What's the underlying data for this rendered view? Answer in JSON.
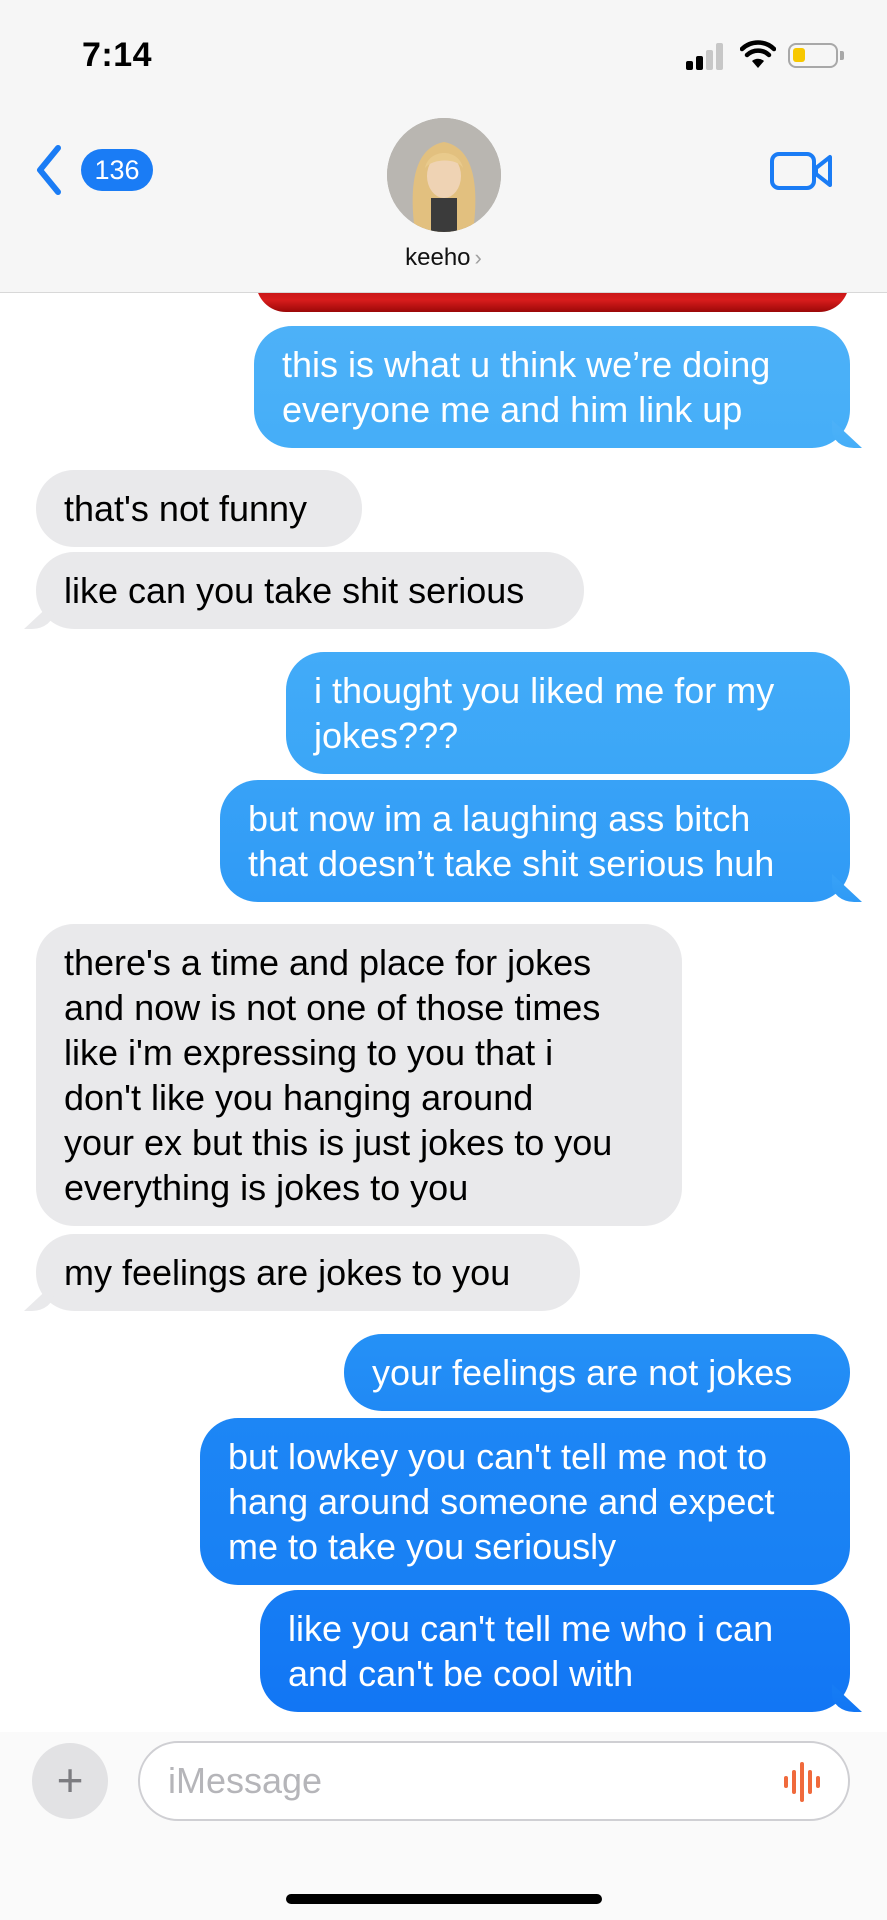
{
  "status_bar": {
    "time": "7:14"
  },
  "header": {
    "back_count": "136",
    "contact_name": "keeho",
    "name_chevron": "›"
  },
  "messages": [
    {
      "from": "me",
      "text": "this is what u think we’re doing\neveryone me and him link up"
    },
    {
      "from": "them",
      "text": "that's not funny"
    },
    {
      "from": "them",
      "text": "like can you take shit serious"
    },
    {
      "from": "me",
      "text": "i thought you liked me for my\njokes???"
    },
    {
      "from": "me",
      "text": "but now im a laughing ass bitch\nthat doesn’t take shit serious huh"
    },
    {
      "from": "them",
      "text": "there's a time and place for jokes\nand now is not one of those times\nlike i'm expressing to you that i\ndon't like you hanging around\nyour ex but this is just jokes to you\neverything is jokes to you"
    },
    {
      "from": "them",
      "text": "my feelings are jokes to you"
    },
    {
      "from": "me",
      "text": "your feelings are not jokes"
    },
    {
      "from": "me",
      "text": "but lowkey you can't tell me not to\nhang around someone and expect\nme to take you seriously"
    },
    {
      "from": "me",
      "text": "like you can't tell me who i can\nand can't be cool with"
    }
  ],
  "composer": {
    "plus": "+",
    "placeholder": "iMessage"
  },
  "colors": {
    "sent_top": "#45aef8",
    "sent_bottom": "#1276f4",
    "received": "#e9e9eb",
    "accent": "#1a7cf5",
    "audio": "#f06a3c"
  },
  "icons": [
    "back-chevron-icon",
    "video-camera-icon",
    "plus-icon",
    "audio-waveform-icon",
    "wifi-icon",
    "battery-icon",
    "cellular-signal-icon"
  ]
}
